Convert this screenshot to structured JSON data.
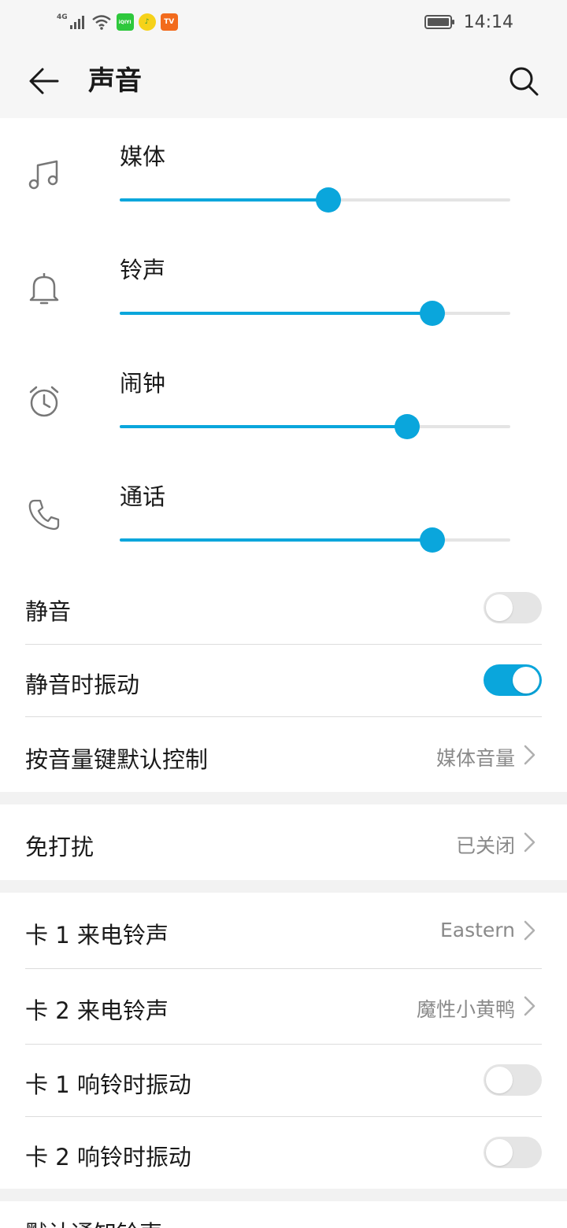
{
  "status_bar": {
    "network": "4G",
    "app_icons": [
      "iqiyi-icon",
      "qq-music-icon",
      "mgtv-icon"
    ],
    "app_icon_labels": [
      "iQIYI",
      "♪",
      "TV"
    ],
    "time": "14:14"
  },
  "header": {
    "title": "声音"
  },
  "volumes": [
    {
      "label": "媒体",
      "icon": "music-note-icon",
      "level": 0.535
    },
    {
      "label": "铃声",
      "icon": "bell-icon",
      "level": 0.8
    },
    {
      "label": "闹钟",
      "icon": "alarm-clock-icon",
      "level": 0.735
    },
    {
      "label": "通话",
      "icon": "phone-icon",
      "level": 0.8
    }
  ],
  "settings": {
    "mute": {
      "label": "静音",
      "on": false
    },
    "vibrate_on_mute": {
      "label": "静音时振动",
      "on": true
    },
    "volume_key_default": {
      "label": "按音量键默认控制",
      "value": "媒体音量"
    },
    "do_not_disturb": {
      "label": "免打扰",
      "value": "已关闭"
    },
    "sim1_ringtone": {
      "label": "卡 1 来电铃声",
      "value": "Eastern"
    },
    "sim2_ringtone": {
      "label": "卡 2 来电铃声",
      "value": "魔性小黄鸭"
    },
    "sim1_vibrate": {
      "label": "卡 1 响铃时振动",
      "on": false
    },
    "sim2_vibrate": {
      "label": "卡 2 响铃时振动",
      "on": false
    },
    "default_notification": {
      "label": "默认通知铃声"
    }
  },
  "colors": {
    "accent": "#0aa6dc",
    "background": "#f6f6f6",
    "divider": "#dcdcdc",
    "secondary_text": "#8a8a8a"
  }
}
